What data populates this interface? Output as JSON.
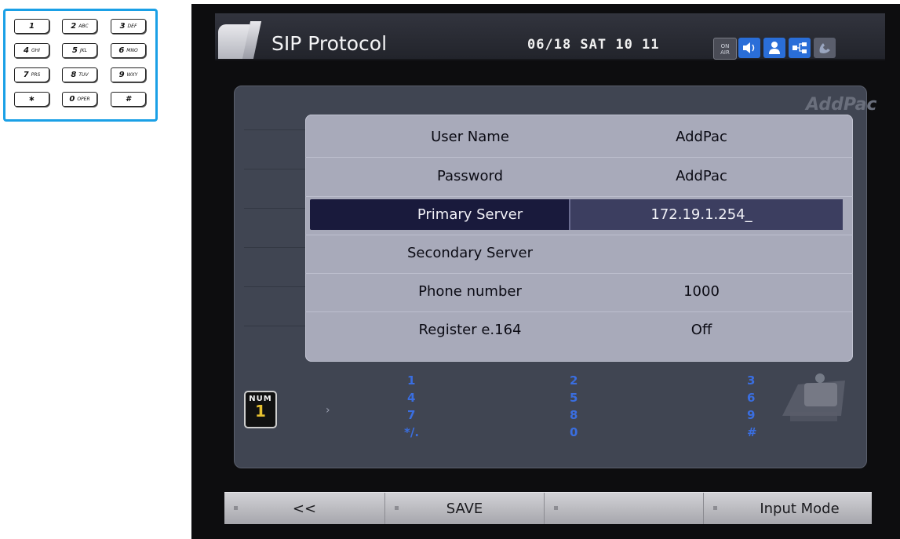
{
  "keypad": {
    "keys": [
      {
        "main": "1",
        "sub": ""
      },
      {
        "main": "2",
        "sub": "ABC"
      },
      {
        "main": "3",
        "sub": "DEF"
      },
      {
        "main": "4",
        "sub": "GHI"
      },
      {
        "main": "5",
        "sub": "JKL"
      },
      {
        "main": "6",
        "sub": "MNO"
      },
      {
        "main": "7",
        "sub": "PRS"
      },
      {
        "main": "8",
        "sub": "TUV"
      },
      {
        "main": "9",
        "sub": "WXY"
      },
      {
        "main": "∗",
        "sub": ""
      },
      {
        "main": "0",
        "sub": "OPER"
      },
      {
        "main": "#",
        "sub": ""
      }
    ]
  },
  "header": {
    "title": "SIP Protocol",
    "datetime": "06/18 SAT 10 11",
    "status_icons": [
      "on-air-icon",
      "speaker-icon",
      "user-icon",
      "network-icon",
      "handset-icon"
    ],
    "on_air_text": "ON\nAIR"
  },
  "brand": "AddPac",
  "form": {
    "rows": [
      {
        "label": "User Name",
        "value": "AddPac"
      },
      {
        "label": "Password",
        "value": "AddPac"
      },
      {
        "label": "Primary Server",
        "value": "172.19.1.254_"
      },
      {
        "label": "Secondary Server",
        "value": ""
      },
      {
        "label": "Phone number",
        "value": "1000"
      },
      {
        "label": "Register e.164",
        "value": "Off"
      }
    ],
    "selected_index": 2
  },
  "input_mode": {
    "label": "NUM",
    "value": "1",
    "indicator": "›",
    "columns": [
      [
        "1",
        "4",
        "7",
        "*/."
      ],
      [
        "2",
        "5",
        "8",
        "0"
      ],
      [
        "3",
        "6",
        "9",
        "#"
      ]
    ]
  },
  "softkeys": [
    {
      "label": "<<"
    },
    {
      "label": "SAVE"
    },
    {
      "label": ""
    },
    {
      "label": "Input Mode"
    }
  ],
  "colors": {
    "accent": "#1aa0e6",
    "selection": "#191a3c",
    "digits": "#3a6ee0",
    "num_value": "#e6c030"
  }
}
